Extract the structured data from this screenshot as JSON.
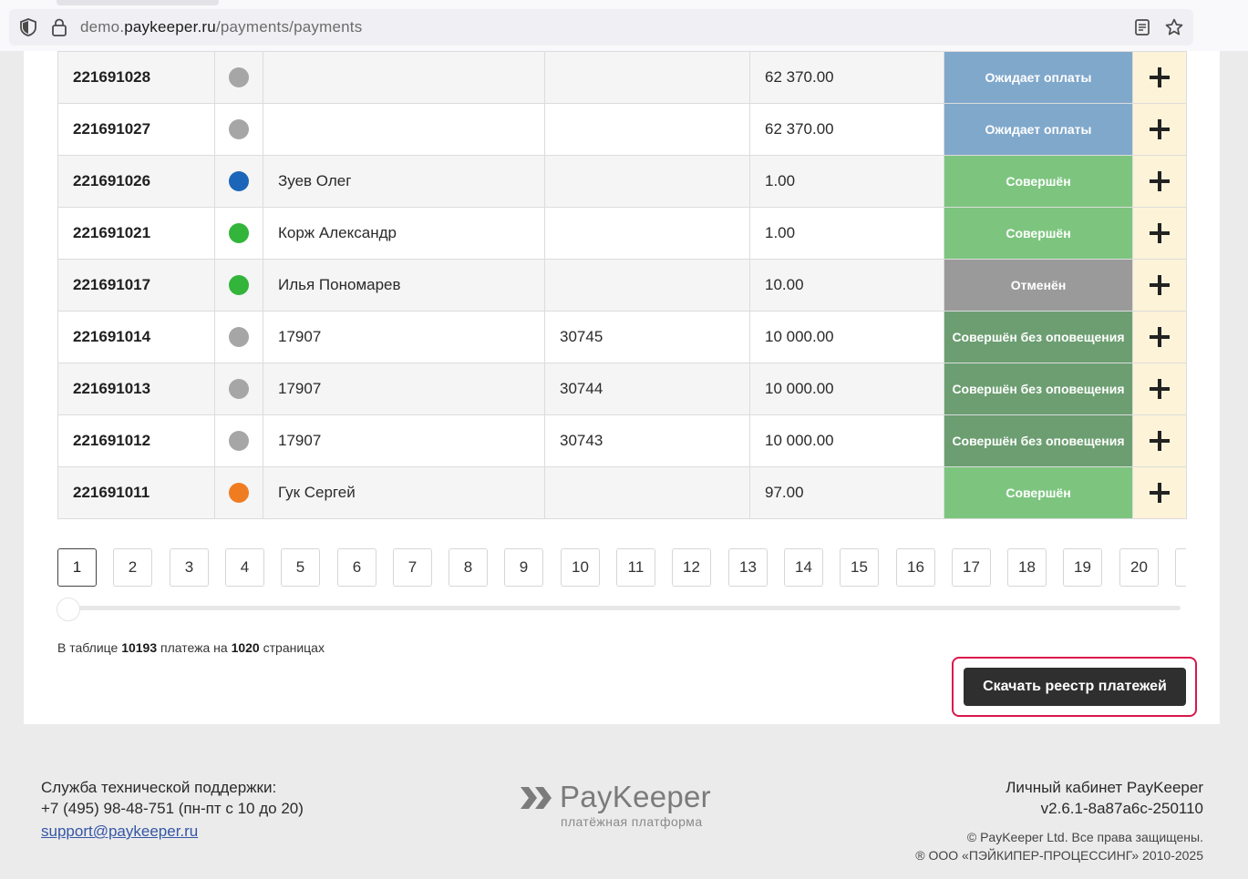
{
  "browser": {
    "url_domain_prefix": "demo.",
    "url_domain": "paykeeper.ru",
    "url_path": "/payments/payments"
  },
  "colors": {
    "awaiting": "#80a8cb",
    "done": "#7dc57f",
    "cancelled": "#9a9a9a",
    "done_silent": "#6c9e71",
    "dot_gray": "#a6a6a6",
    "dot_blue": "#1b66b8",
    "dot_green": "#33b43a",
    "dot_orange": "#f07c22",
    "highlight_frame": "#d9174c"
  },
  "rows": [
    {
      "id": "221691028",
      "dot": "gray",
      "name": "",
      "order": "",
      "sum": "62 370.00",
      "status": "Ожидает оплаты",
      "status_kind": "awaiting"
    },
    {
      "id": "221691027",
      "dot": "gray",
      "name": "",
      "order": "",
      "sum": "62 370.00",
      "status": "Ожидает оплаты",
      "status_kind": "awaiting"
    },
    {
      "id": "221691026",
      "dot": "blue",
      "name": "Зуев Олег",
      "order": "",
      "sum": "1.00",
      "status": "Совершён",
      "status_kind": "done"
    },
    {
      "id": "221691021",
      "dot": "green",
      "name": "Корж Александр",
      "order": "",
      "sum": "1.00",
      "status": "Совершён",
      "status_kind": "done"
    },
    {
      "id": "221691017",
      "dot": "green",
      "name": "Илья Пономарев",
      "order": "",
      "sum": "10.00",
      "status": "Отменён",
      "status_kind": "cancelled"
    },
    {
      "id": "221691014",
      "dot": "gray",
      "name": "17907",
      "order": "30745",
      "sum": "10 000.00",
      "status": "Совершён без оповещения",
      "status_kind": "done_silent"
    },
    {
      "id": "221691013",
      "dot": "gray",
      "name": "17907",
      "order": "30744",
      "sum": "10 000.00",
      "status": "Совершён без оповещения",
      "status_kind": "done_silent"
    },
    {
      "id": "221691012",
      "dot": "gray",
      "name": "17907",
      "order": "30743",
      "sum": "10 000.00",
      "status": "Совершён без оповещения",
      "status_kind": "done_silent"
    },
    {
      "id": "221691011",
      "dot": "orange",
      "name": "Гук Сергей",
      "order": "",
      "sum": "97.00",
      "status": "Совершён",
      "status_kind": "done"
    }
  ],
  "pagination": {
    "pages": [
      "1",
      "2",
      "3",
      "4",
      "5",
      "6",
      "7",
      "8",
      "9",
      "10",
      "11",
      "12",
      "13",
      "14",
      "15",
      "16",
      "17",
      "18",
      "19",
      "20"
    ],
    "current": "1"
  },
  "summary": {
    "prefix": "В таблице",
    "total_payments": "10193",
    "middle": "платежа на",
    "total_pages": "1020",
    "suffix": "страницах"
  },
  "download_button": "Скачать реестр платежей",
  "footer": {
    "support_title": "Служба технической поддержки:",
    "support_phone": "+7 (495) 98-48-751 (пн-пт с 10 до 20)",
    "support_email": "support@paykeeper.ru",
    "logo_name": "PayKeeper",
    "logo_sub": "платёжная платформа",
    "cabinet_title": "Личный кабинет PayKeeper",
    "version": "v2.6.1-8a87a6c-250110",
    "copyright": "© PayKeeper Ltd. Все права защищены.",
    "company": "® ООО «ПЭЙКИПЕР-ПРОЦЕССИНГ» 2010-2025"
  }
}
